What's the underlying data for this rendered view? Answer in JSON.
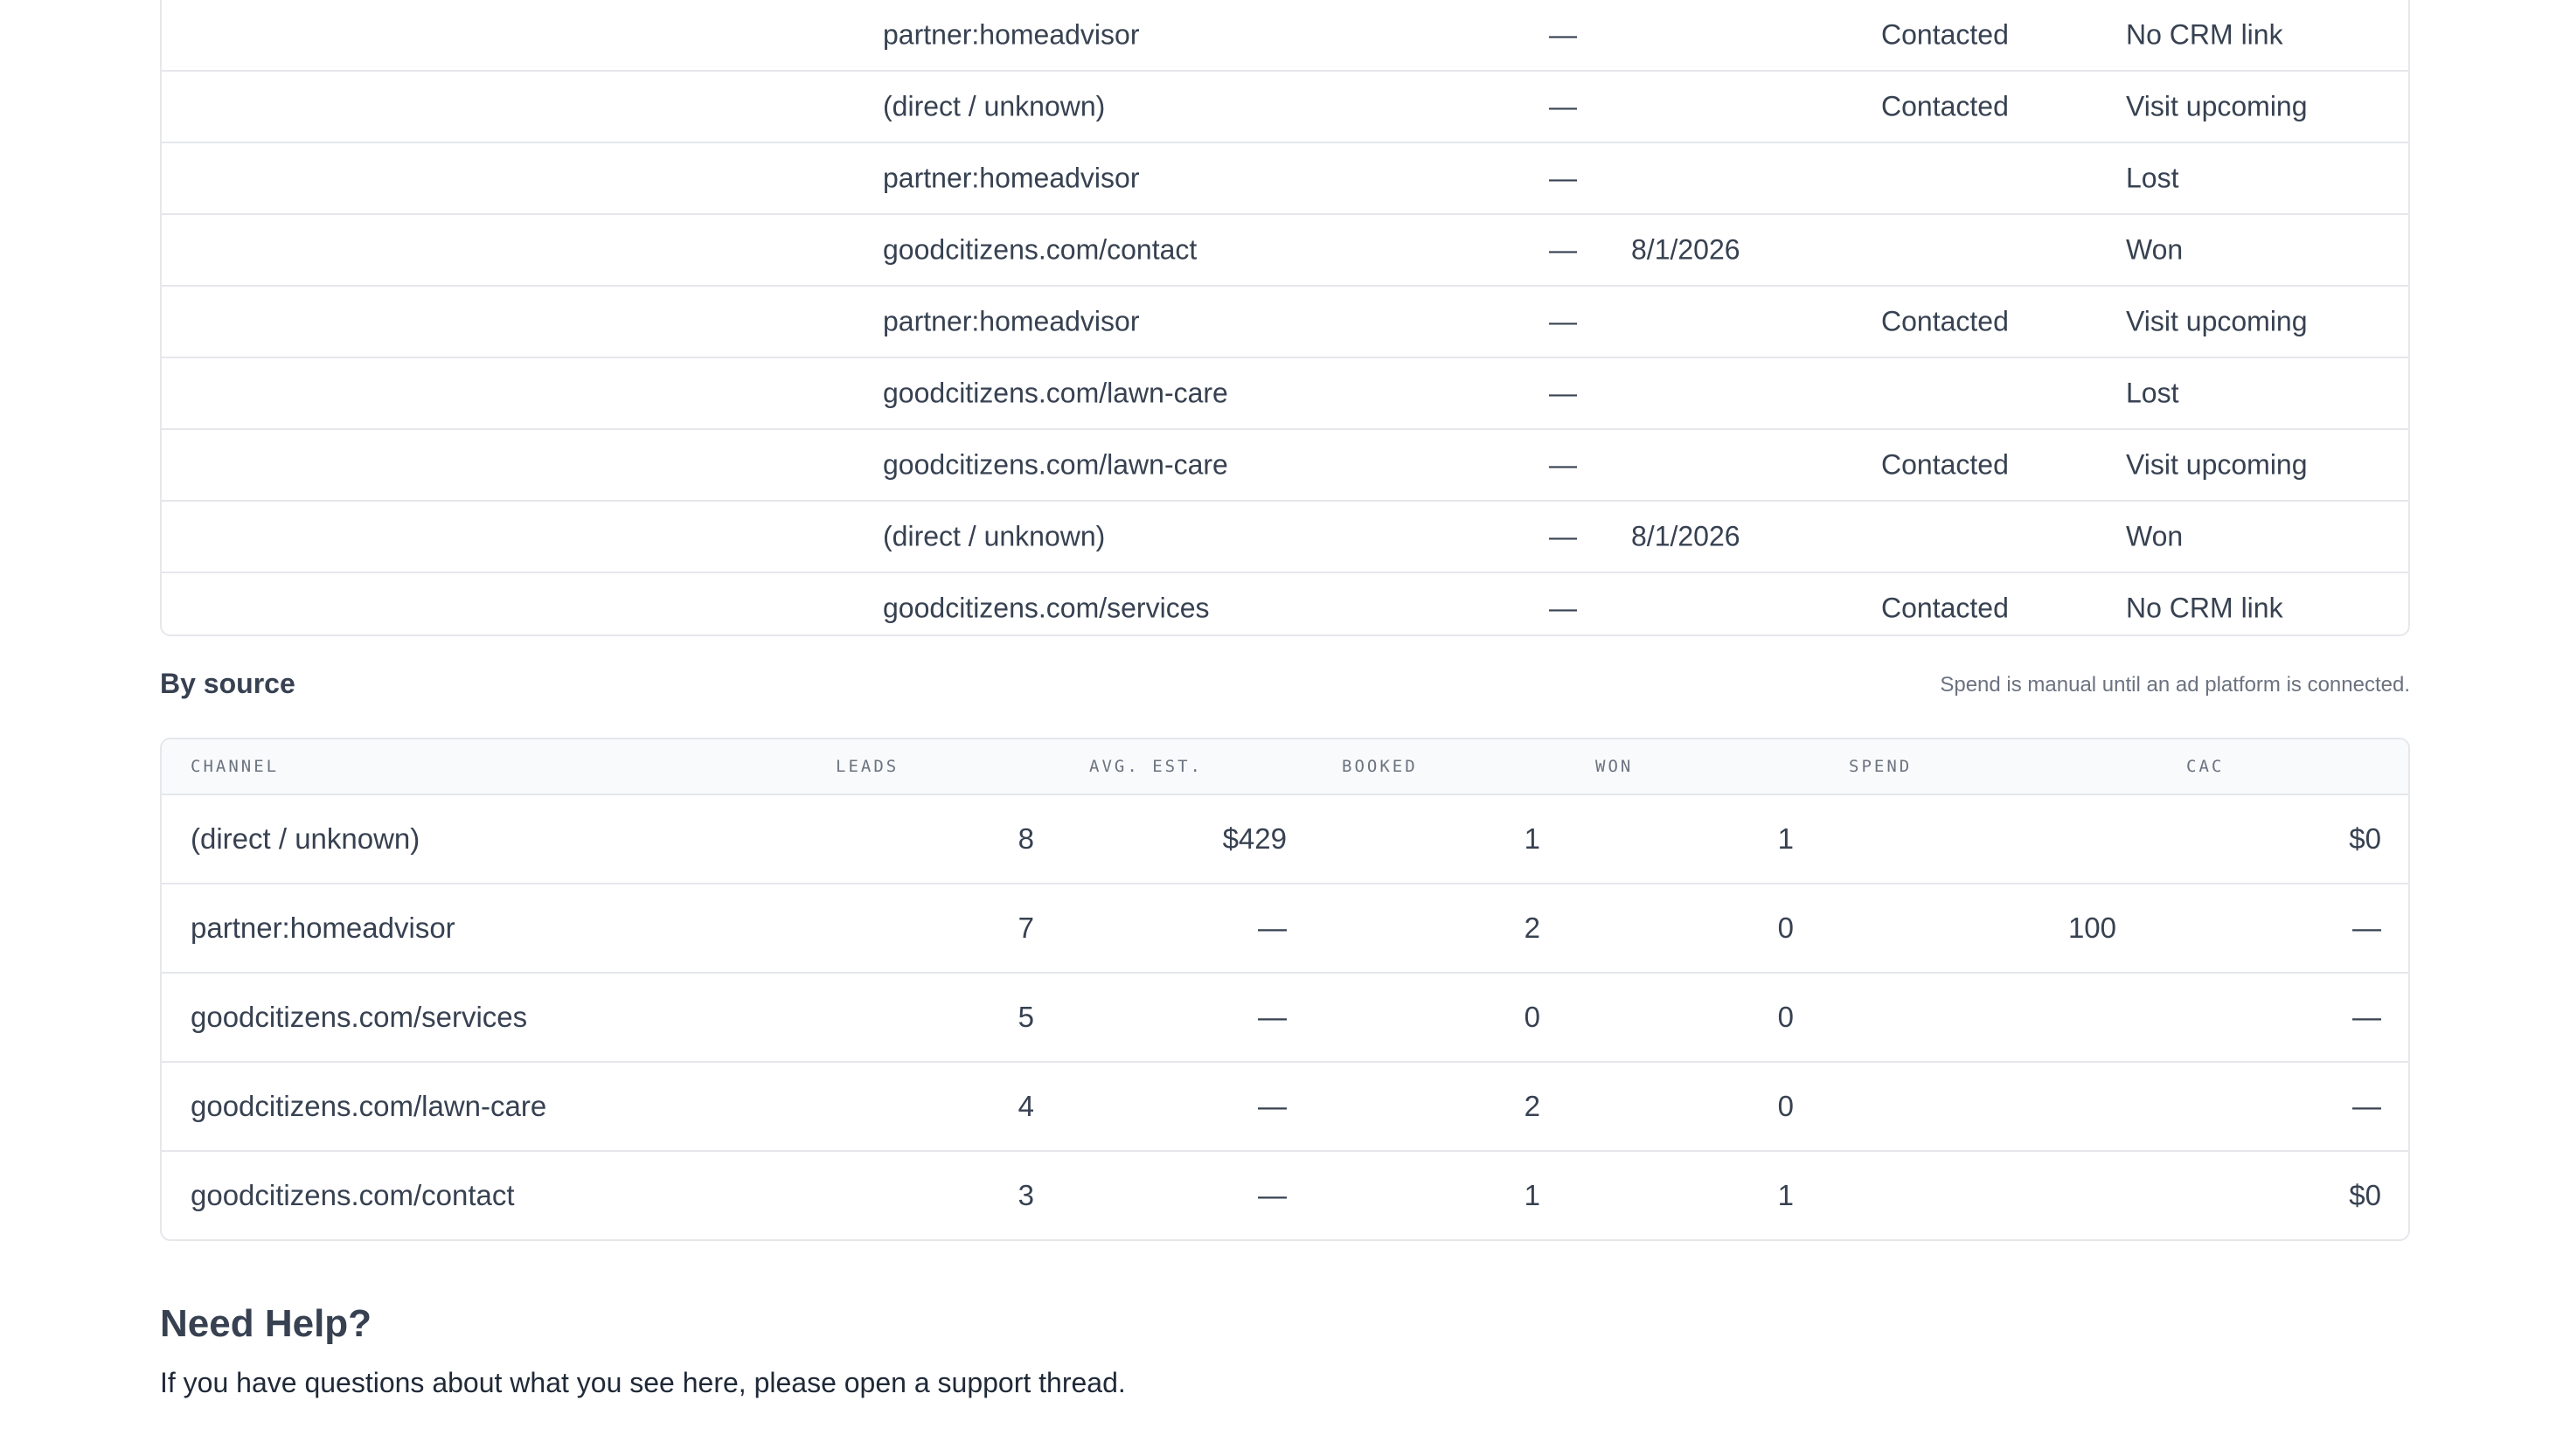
{
  "leads_rows": [
    {
      "source": "partner:homeadvisor",
      "value": "—",
      "date": "",
      "crm": "Contacted",
      "status": "No CRM link"
    },
    {
      "source": "(direct / unknown)",
      "value": "—",
      "date": "",
      "crm": "Contacted",
      "status": "Visit upcoming"
    },
    {
      "source": "partner:homeadvisor",
      "value": "—",
      "date": "",
      "crm": "",
      "status": "Lost"
    },
    {
      "source": "goodcitizens.com/contact",
      "value": "—",
      "date": "8/1/2026",
      "crm": "",
      "status": "Won"
    },
    {
      "source": "partner:homeadvisor",
      "value": "—",
      "date": "",
      "crm": "Contacted",
      "status": "Visit upcoming"
    },
    {
      "source": "goodcitizens.com/lawn-care",
      "value": "—",
      "date": "",
      "crm": "",
      "status": "Lost"
    },
    {
      "source": "goodcitizens.com/lawn-care",
      "value": "—",
      "date": "",
      "crm": "Contacted",
      "status": "Visit upcoming"
    },
    {
      "source": "(direct / unknown)",
      "value": "—",
      "date": "8/1/2026",
      "crm": "",
      "status": "Won"
    },
    {
      "source": "goodcitizens.com/services",
      "value": "—",
      "date": "",
      "crm": "Contacted",
      "status": "No CRM link"
    }
  ],
  "by_source": {
    "title": "By source",
    "note": "Spend is manual until an ad platform is connected.",
    "columns": {
      "channel": "CHANNEL",
      "leads": "LEADS",
      "avg_est": "AVG. EST.",
      "booked": "BOOKED",
      "won": "WON",
      "spend": "SPEND",
      "cac": "CAC"
    },
    "rows": [
      {
        "channel": "(direct / unknown)",
        "leads": "8",
        "avg_est": "$429",
        "booked": "1",
        "won": "1",
        "spend": "",
        "cac": "$0"
      },
      {
        "channel": "partner:homeadvisor",
        "leads": "7",
        "avg_est": "—",
        "booked": "2",
        "won": "0",
        "spend": "100",
        "cac": "—"
      },
      {
        "channel": "goodcitizens.com/services",
        "leads": "5",
        "avg_est": "—",
        "booked": "0",
        "won": "0",
        "spend": "",
        "cac": "—"
      },
      {
        "channel": "goodcitizens.com/lawn-care",
        "leads": "4",
        "avg_est": "—",
        "booked": "2",
        "won": "0",
        "spend": "",
        "cac": "—"
      },
      {
        "channel": "goodcitizens.com/contact",
        "leads": "3",
        "avg_est": "—",
        "booked": "1",
        "won": "1",
        "spend": "",
        "cac": "$0"
      }
    ]
  },
  "help": {
    "title": "Need Help?",
    "text": "If you have questions about what you see here, please open a support thread."
  }
}
